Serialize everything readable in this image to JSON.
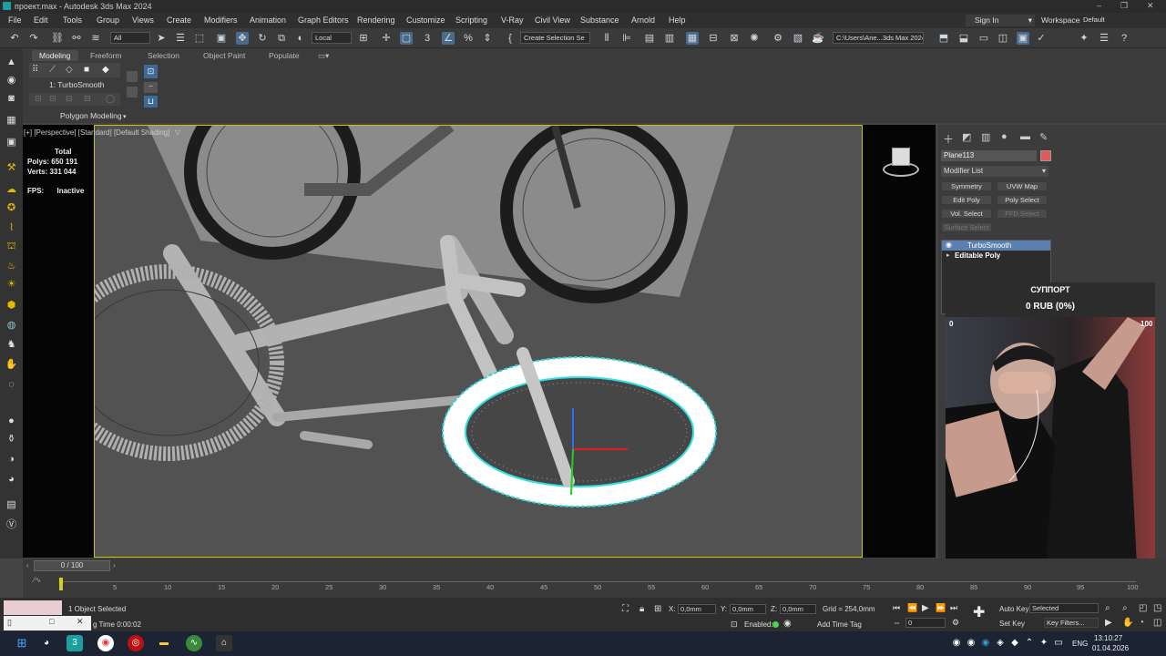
{
  "window": {
    "title": "проект.max - Autodesk 3ds Max 2024",
    "controls": [
      "–",
      "❐",
      "✕"
    ]
  },
  "menu": {
    "items": [
      "File",
      "Edit",
      "Tools",
      "Group",
      "Views",
      "Create",
      "Modifiers",
      "Animation",
      "Graph Editors",
      "Rendering",
      "Customize",
      "Scripting",
      "V-Ray",
      "Civil View",
      "Substance",
      "Arnold",
      "Help"
    ],
    "sign_in": "Sign In",
    "workspaces_label": "Workspaces:",
    "workspaces_value": "Default"
  },
  "toolbar": {
    "selection_filter": "All",
    "coord_system": "Local",
    "named_selection": "Create Selection Se",
    "path": "C:\\Users\\Ane...3ds Max 2024"
  },
  "ribbon": {
    "tabs": [
      "Modeling",
      "Freeform",
      "Selection",
      "Object Paint",
      "Populate"
    ],
    "active_tab": "Modeling",
    "modifier_label": "1: TurboSmooth",
    "panel_label": "Polygon Modeling"
  },
  "viewport": {
    "label": "[+] [Perspective] [Standard] [Default Shading]",
    "stats_header": "Total",
    "polys_label": "Polys:",
    "polys_value": "650 191",
    "verts_label": "Verts:",
    "verts_value": "331 044",
    "fps_label": "FPS:",
    "fps_value": "Inactive"
  },
  "command_panel": {
    "object_name": "Plane113",
    "object_color": "#e05a5a",
    "modifier_list": "Modifier List",
    "buttons": [
      "Symmetry",
      "UVW Map",
      "Edit Poly",
      "Poly Select",
      "Vol. Select",
      "FFD Select",
      "Surface Select"
    ],
    "stack": [
      "TurboSmooth",
      "Editable Poly"
    ]
  },
  "donation": {
    "title": "СУППОРТ",
    "amount": "0 RUB (0%)",
    "min": "0",
    "max": "100"
  },
  "timeline": {
    "frame_display": "0 / 100",
    "ticks": [
      "0",
      "5",
      "10",
      "15",
      "20",
      "25",
      "30",
      "35",
      "40",
      "45",
      "50",
      "55",
      "60",
      "65",
      "70",
      "75",
      "80",
      "85",
      "90",
      "95",
      "100"
    ]
  },
  "status": {
    "selected": "1 Object Selected",
    "render_time": "g Time 0:00:02",
    "x_label": "X:",
    "x_value": "0,0mm",
    "y_label": "Y:",
    "y_value": "0,0mm",
    "z_label": "Z:",
    "z_value": "0,0mm",
    "grid": "Grid = 254,0mm",
    "enabled": "Enabled:",
    "add_time_tag": "Add Time Tag",
    "auto_key": "Auto Key",
    "set_key": "Set Key",
    "selected_dropdown": "Selected",
    "key_filters": "Key Filters...",
    "frame_field": "0"
  },
  "taskbar": {
    "lang": "ENG",
    "time": "13:10:27",
    "date": "01.04.2026"
  }
}
